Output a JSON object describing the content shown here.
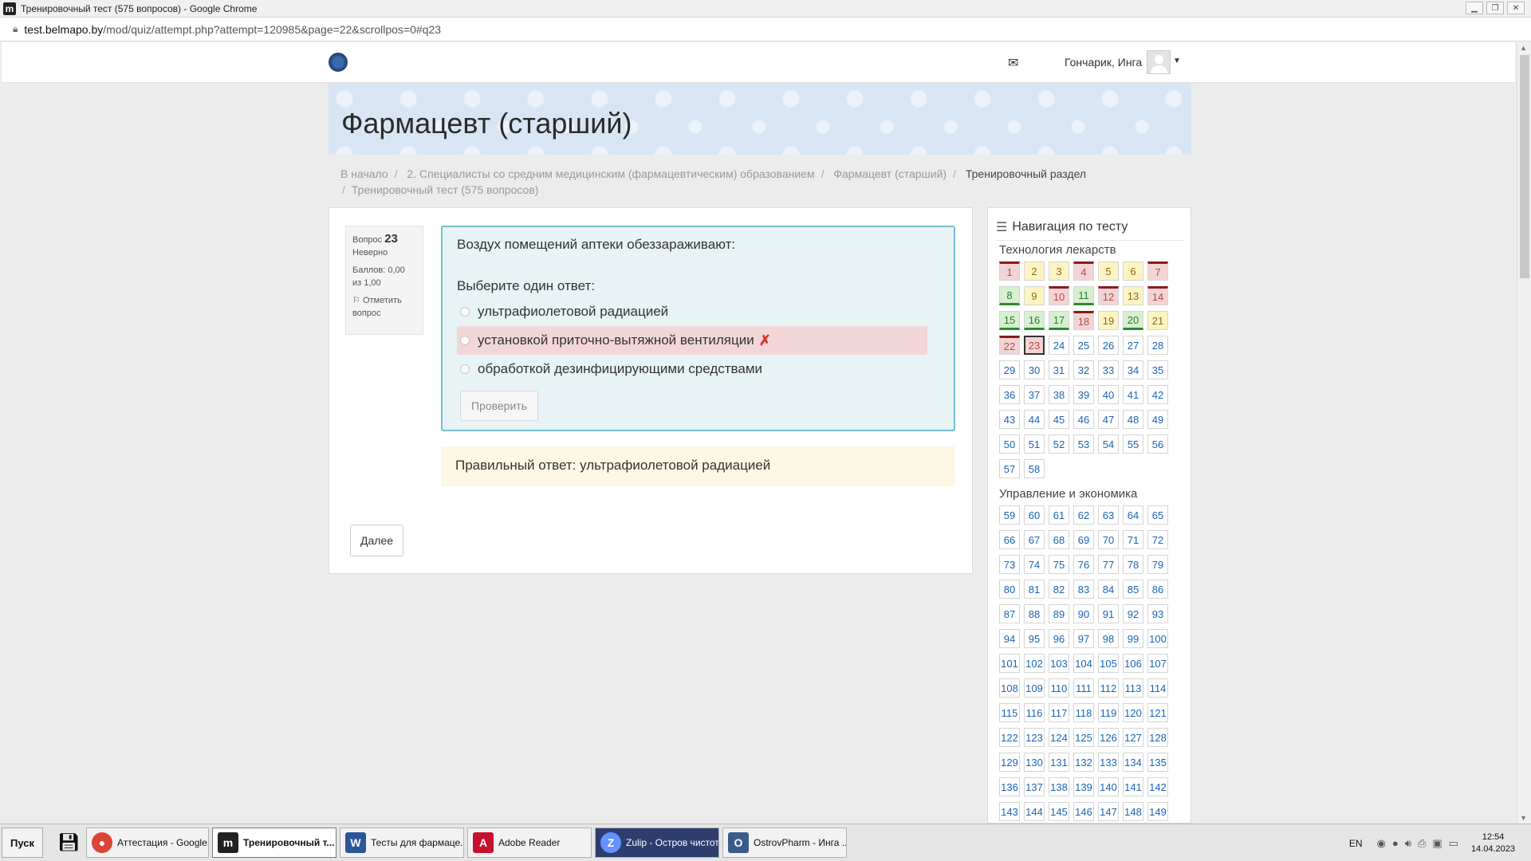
{
  "window": {
    "title": "Тренировочный тест (575 вопросов) - Google Chrome",
    "app_glyph": "m"
  },
  "address": {
    "host": "test.belmapo.by",
    "path": "/mod/quiz/attempt.php?attempt=120985&page=22&scrollpos=0#q23"
  },
  "navbar": {
    "username": "Гончарик, Инга"
  },
  "header": {
    "course_title": "Фармацевт (старший)"
  },
  "breadcrumb": {
    "items": [
      "В начало",
      "2. Специалисты со средним медицинским (фармацевтическим) образованием",
      "Фармацевт (старший)",
      "Тренировочный раздел"
    ],
    "last": "Тренировочный тест (575 вопросов)"
  },
  "question": {
    "label": "Вопрос",
    "number": "23",
    "state": "Неверно",
    "grade": "Баллов: 0,00 из 1,00",
    "flag_label": "Отметить вопрос",
    "text": "Воздух помещений аптеки обеззараживают:",
    "prompt": "Выберите один ответ:",
    "answers": [
      "ультрафиолетовой радиацией",
      "установкой приточно-вытяжной вентиляции",
      "обработкой дезинфицирующими средствами"
    ],
    "check_label": "Проверить",
    "right_answer": "Правильный ответ: ультрафиолетовой радиацией",
    "next_label": "Далее"
  },
  "quiz_nav": {
    "title": "Навигация по тесту",
    "sections": [
      {
        "title": "Технология лекарств",
        "buttons": [
          {
            "n": "1",
            "s": "incorrect"
          },
          {
            "n": "2",
            "s": "partial"
          },
          {
            "n": "3",
            "s": "partial"
          },
          {
            "n": "4",
            "s": "incorrect"
          },
          {
            "n": "5",
            "s": "partial"
          },
          {
            "n": "6",
            "s": "partial"
          },
          {
            "n": "7",
            "s": "incorrect"
          },
          {
            "n": "8",
            "s": "correct"
          },
          {
            "n": "9",
            "s": "partial"
          },
          {
            "n": "10",
            "s": "incorrect"
          },
          {
            "n": "11",
            "s": "correct"
          },
          {
            "n": "12",
            "s": "incorrect"
          },
          {
            "n": "13",
            "s": "partial"
          },
          {
            "n": "14",
            "s": "incorrect"
          },
          {
            "n": "15",
            "s": "correct"
          },
          {
            "n": "16",
            "s": "correct"
          },
          {
            "n": "17",
            "s": "correct"
          },
          {
            "n": "18",
            "s": "incorrect"
          },
          {
            "n": "19",
            "s": "partial"
          },
          {
            "n": "20",
            "s": "correct"
          },
          {
            "n": "21",
            "s": "partial"
          },
          {
            "n": "22",
            "s": "incorrect"
          },
          {
            "n": "23",
            "s": "incorrect current"
          },
          {
            "n": "24",
            "s": ""
          },
          {
            "n": "25",
            "s": ""
          },
          {
            "n": "26",
            "s": ""
          },
          {
            "n": "27",
            "s": ""
          },
          {
            "n": "28",
            "s": ""
          },
          {
            "n": "29",
            "s": ""
          },
          {
            "n": "30",
            "s": ""
          },
          {
            "n": "31",
            "s": ""
          },
          {
            "n": "32",
            "s": ""
          },
          {
            "n": "33",
            "s": ""
          },
          {
            "n": "34",
            "s": ""
          },
          {
            "n": "35",
            "s": ""
          },
          {
            "n": "36",
            "s": ""
          },
          {
            "n": "37",
            "s": ""
          },
          {
            "n": "38",
            "s": ""
          },
          {
            "n": "39",
            "s": ""
          },
          {
            "n": "40",
            "s": ""
          },
          {
            "n": "41",
            "s": ""
          },
          {
            "n": "42",
            "s": ""
          },
          {
            "n": "43",
            "s": ""
          },
          {
            "n": "44",
            "s": ""
          },
          {
            "n": "45",
            "s": ""
          },
          {
            "n": "46",
            "s": ""
          },
          {
            "n": "47",
            "s": ""
          },
          {
            "n": "48",
            "s": ""
          },
          {
            "n": "49",
            "s": ""
          },
          {
            "n": "50",
            "s": ""
          },
          {
            "n": "51",
            "s": ""
          },
          {
            "n": "52",
            "s": ""
          },
          {
            "n": "53",
            "s": ""
          },
          {
            "n": "54",
            "s": ""
          },
          {
            "n": "55",
            "s": ""
          },
          {
            "n": "56",
            "s": ""
          },
          {
            "n": "57",
            "s": ""
          },
          {
            "n": "58",
            "s": ""
          }
        ]
      },
      {
        "title": "Управление и экономика",
        "range": [
          "59",
          "149"
        ]
      }
    ]
  },
  "taskbar": {
    "start": "Пуск",
    "tasks": [
      "Аттестация - Google...",
      "Тренировочный т...",
      "Тесты для фармаце...",
      "Adobe Reader",
      "Zulip - Остров чистоты",
      "OstrovPharm - Инга ..."
    ],
    "lang": "EN",
    "time": "12:54",
    "date": "14.04.2023"
  }
}
